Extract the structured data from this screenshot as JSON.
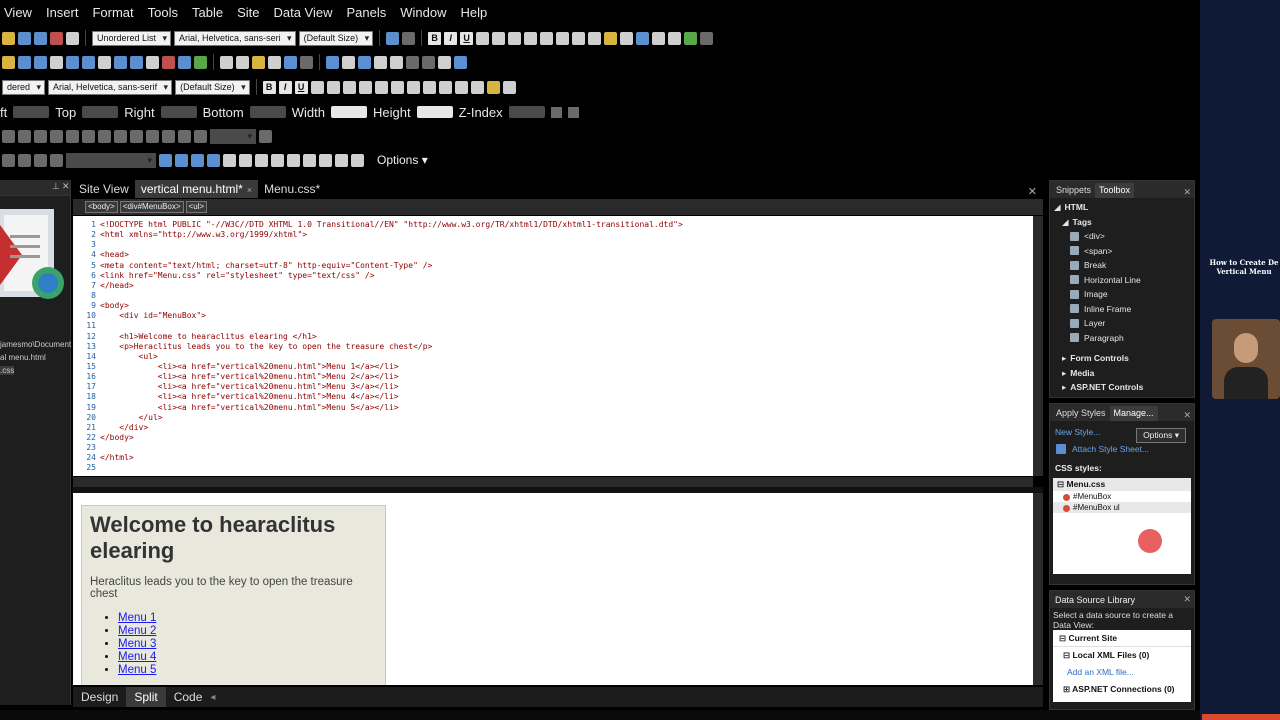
{
  "menubar": [
    "View",
    "Insert",
    "Format",
    "Tools",
    "Table",
    "Site",
    "Data View",
    "Panels",
    "Window",
    "Help"
  ],
  "toolbar1": {
    "style_dd": "Unordered List",
    "font_dd": "Arial, Helvetica, sans-seri",
    "size_dd": "(Default Size)"
  },
  "toolbar3": {
    "style_dd": "dered",
    "font_dd": "Arial, Helvetica, sans-serif",
    "size_dd": "(Default Size)"
  },
  "position": {
    "left_label": "ft",
    "top_label": "Top",
    "right_label": "Right",
    "bottom_label": "Bottom",
    "width_label": "Width",
    "height_label": "Height",
    "zindex_label": "Z-Index"
  },
  "toolbar5": {
    "options_label": "Options"
  },
  "left_panel": {
    "path_text": "jamesmo\\Document",
    "file1": "al menu.html",
    "file2": ".css"
  },
  "doc_tabs": {
    "site_view": "Site View",
    "active_tab": "vertical menu.html*",
    "close_glyph": "×",
    "css_tab": "Menu.css*"
  },
  "tag_selector": [
    "<body>",
    "<div#MenuBox>",
    "<ul>"
  ],
  "code": [
    {
      "n": "1",
      "t": "<!DOCTYPE html PUBLIC \"-//W3C//DTD XHTML 1.0 Transitional//EN\" \"http://www.w3.org/TR/xhtml1/DTD/xhtml1-transitional.dtd\">"
    },
    {
      "n": "2",
      "t": "<html xmlns=\"http://www.w3.org/1999/xhtml\">"
    },
    {
      "n": "3",
      "t": ""
    },
    {
      "n": "4",
      "t": "<head>"
    },
    {
      "n": "5",
      "t": "<meta content=\"text/html; charset=utf-8\" http-equiv=\"Content-Type\" />"
    },
    {
      "n": "6",
      "t": "<link href=\"Menu.css\" rel=\"stylesheet\" type=\"text/css\" />"
    },
    {
      "n": "7",
      "t": "</head>"
    },
    {
      "n": "8",
      "t": ""
    },
    {
      "n": "9",
      "t": "<body>"
    },
    {
      "n": "10",
      "t": "    <div id=\"MenuBox\">"
    },
    {
      "n": "11",
      "t": ""
    },
    {
      "n": "12",
      "t": "    <h1>Welcome to hearaclitus elearing </h1>"
    },
    {
      "n": "13",
      "t": "    <p>Heraclitus leads you to the key to open the treasure chest</p>"
    },
    {
      "n": "14",
      "t": "        <ul>"
    },
    {
      "n": "15",
      "t": "            <li><a href=\"vertical%20menu.html\">Menu 1</a></li>"
    },
    {
      "n": "16",
      "t": "            <li><a href=\"vertical%20menu.html\">Menu 2</a></li>"
    },
    {
      "n": "17",
      "t": "            <li><a href=\"vertical%20menu.html\">Menu 3</a></li>"
    },
    {
      "n": "18",
      "t": "            <li><a href=\"vertical%20menu.html\">Menu 4</a></li>"
    },
    {
      "n": "19",
      "t": "            <li><a href=\"vertical%20menu.html\">Menu 5</a></li>"
    },
    {
      "n": "20",
      "t": "        </ul>"
    },
    {
      "n": "21",
      "t": "    </div>"
    },
    {
      "n": "22",
      "t": "</body>"
    },
    {
      "n": "23",
      "t": ""
    },
    {
      "n": "24",
      "t": "</html>"
    },
    {
      "n": "25",
      "t": ""
    }
  ],
  "design": {
    "heading": "Welcome to hearaclitus elearing",
    "paragraph": "Heraclitus leads you to the key to open the treasure chest",
    "menu_items": [
      "Menu 1",
      "Menu 2",
      "Menu 3",
      "Menu 4",
      "Menu 5"
    ]
  },
  "view_tabs": {
    "design": "Design",
    "split": "Split",
    "code": "Code"
  },
  "toolbox": {
    "tab_snippets": "Snippets",
    "tab_toolbox": "Toolbox",
    "html": "HTML",
    "tags": "Tags",
    "items": [
      "<div>",
      "<span>",
      "Break",
      "Horizontal Line",
      "Image",
      "Inline Frame",
      "Layer",
      "Paragraph"
    ],
    "form_controls": "Form Controls",
    "media": "Media",
    "aspnet": "ASP.NET Controls"
  },
  "styles": {
    "tab_apply": "Apply Styles",
    "tab_manage": "Manage...",
    "new_style": "New Style...",
    "options": "Options",
    "attach": "Attach Style Sheet...",
    "css_label": "CSS styles:",
    "file": "Menu.css",
    "rules": [
      "#MenuBox",
      "#MenuBox ul"
    ]
  },
  "datasource": {
    "title": "Data Source Library",
    "desc": "Select a data source to create a Data View:",
    "current_site": "Current Site",
    "local_xml": "Local XML Files (0)",
    "add_xml": "Add an XML file...",
    "aspnet_conn": "ASP.NET Connections (0)"
  },
  "video": {
    "title_line1": "How to Create De",
    "title_line2": "Vertical Menu"
  },
  "colors": {
    "accent": "#6aa6e8",
    "link": "#1a1aee",
    "menubox_bg": "#e8e8dd",
    "code_tag": "#900000"
  }
}
